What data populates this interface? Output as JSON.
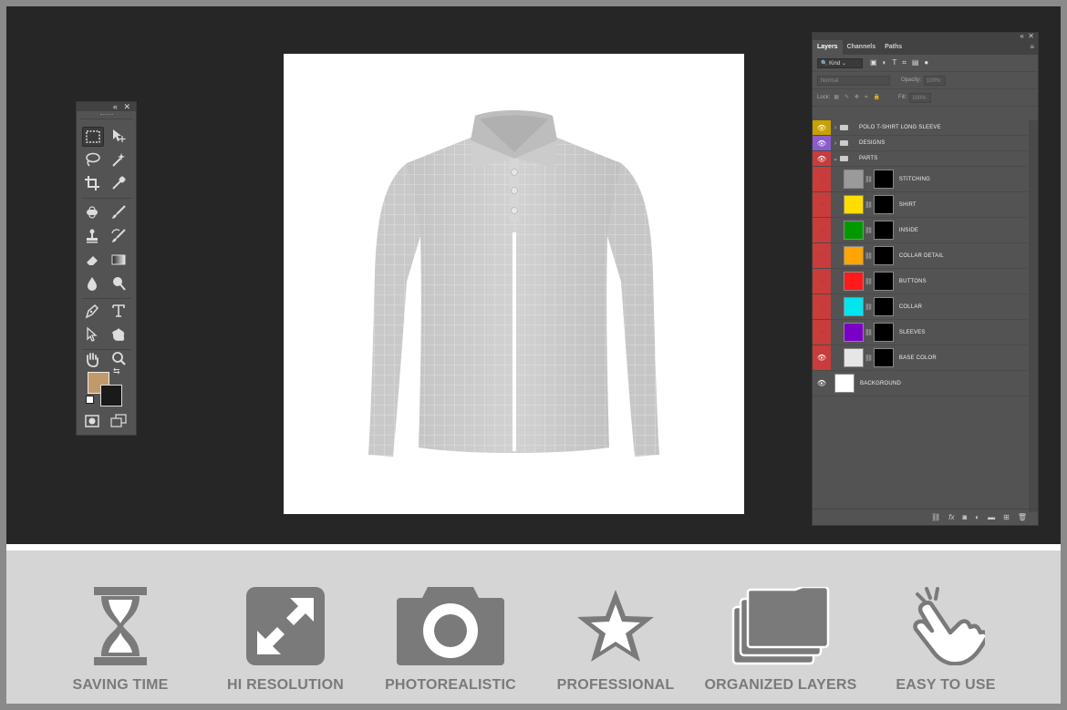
{
  "tools_panel": {
    "collapse_icon": "double-chevron-left",
    "close_icon": "close",
    "tools": [
      "rectangular-marquee",
      "move",
      "lasso",
      "magic-wand",
      "crop",
      "eyedropper",
      "spot-healing",
      "brush",
      "clone-stamp",
      "history-brush",
      "eraser",
      "gradient",
      "blur",
      "dodge",
      "pen",
      "type",
      "path-selection",
      "custom-shape",
      "hand",
      "zoom",
      "quick-mask",
      "screen-mode"
    ],
    "foreground_color": "#c19a6b",
    "background_color": "#1a1a1a"
  },
  "layers_panel": {
    "tabs": [
      {
        "label": "Layers",
        "active": true
      },
      {
        "label": "Channels",
        "active": false
      },
      {
        "label": "Paths",
        "active": false
      }
    ],
    "filter_kind": "Kind",
    "blend_mode": "Normal",
    "opacity_label": "Opacity:",
    "opacity_value": "100%",
    "lock_label": "Lock:",
    "fill_label": "Fill:",
    "fill_value": "100%",
    "layers": [
      {
        "name": "POLO T-SHIRT LONG SLEEVE",
        "type": "group",
        "expanded": false,
        "visible": true,
        "tag_color": "#c8a000"
      },
      {
        "name": "DESIGNS",
        "type": "group",
        "expanded": false,
        "visible": true,
        "tag_color": "#8a5cc8"
      },
      {
        "name": "PARTS",
        "type": "group",
        "expanded": true,
        "visible": true,
        "tag_color": "#c83c3c"
      },
      {
        "name": "STITCHING",
        "type": "layer",
        "visible": false,
        "swatch": "#9a9a9a",
        "tag_color": "#c83c3c"
      },
      {
        "name": "SHIRT",
        "type": "layer",
        "visible": false,
        "swatch": "#ffdd00",
        "tag_color": "#c83c3c"
      },
      {
        "name": "INSIDE",
        "type": "layer",
        "visible": false,
        "swatch": "#009a00",
        "tag_color": "#c83c3c"
      },
      {
        "name": "COLLAR DETAIL",
        "type": "layer",
        "visible": false,
        "swatch": "#ffa500",
        "tag_color": "#c83c3c"
      },
      {
        "name": "BUTTONS",
        "type": "layer",
        "visible": false,
        "swatch": "#ff1a1a",
        "tag_color": "#c83c3c"
      },
      {
        "name": "COLLAR",
        "type": "layer",
        "visible": false,
        "swatch": "#00e5f0",
        "tag_color": "#c83c3c"
      },
      {
        "name": "SLEEVES",
        "type": "layer",
        "visible": false,
        "swatch": "#7a00c8",
        "tag_color": "#c83c3c"
      },
      {
        "name": "BASE COLOR",
        "type": "layer",
        "visible": true,
        "swatch": "#e6e6e6",
        "tag_color": "#c83c3c"
      },
      {
        "name": "BACKGROUND",
        "type": "background",
        "visible": true,
        "swatch": "#ffffff",
        "tag_color": ""
      }
    ]
  },
  "features": [
    {
      "label": "SAVING TIME",
      "icon": "hourglass-icon"
    },
    {
      "label": "HI RESOLUTION",
      "icon": "expand-arrows-icon"
    },
    {
      "label": "PHOTOREALISTIC",
      "icon": "camera-icon"
    },
    {
      "label": "PROFESSIONAL",
      "icon": "star-icon"
    },
    {
      "label": "ORGANIZED LAYERS",
      "icon": "layered-folders-icon"
    },
    {
      "label": "EASY TO USE",
      "icon": "pointing-hand-icon"
    }
  ],
  "colors": {
    "workspace": "#262626",
    "panel": "#535353",
    "footer": "#d5d5d5",
    "icon_gray": "#7a7a7a"
  }
}
